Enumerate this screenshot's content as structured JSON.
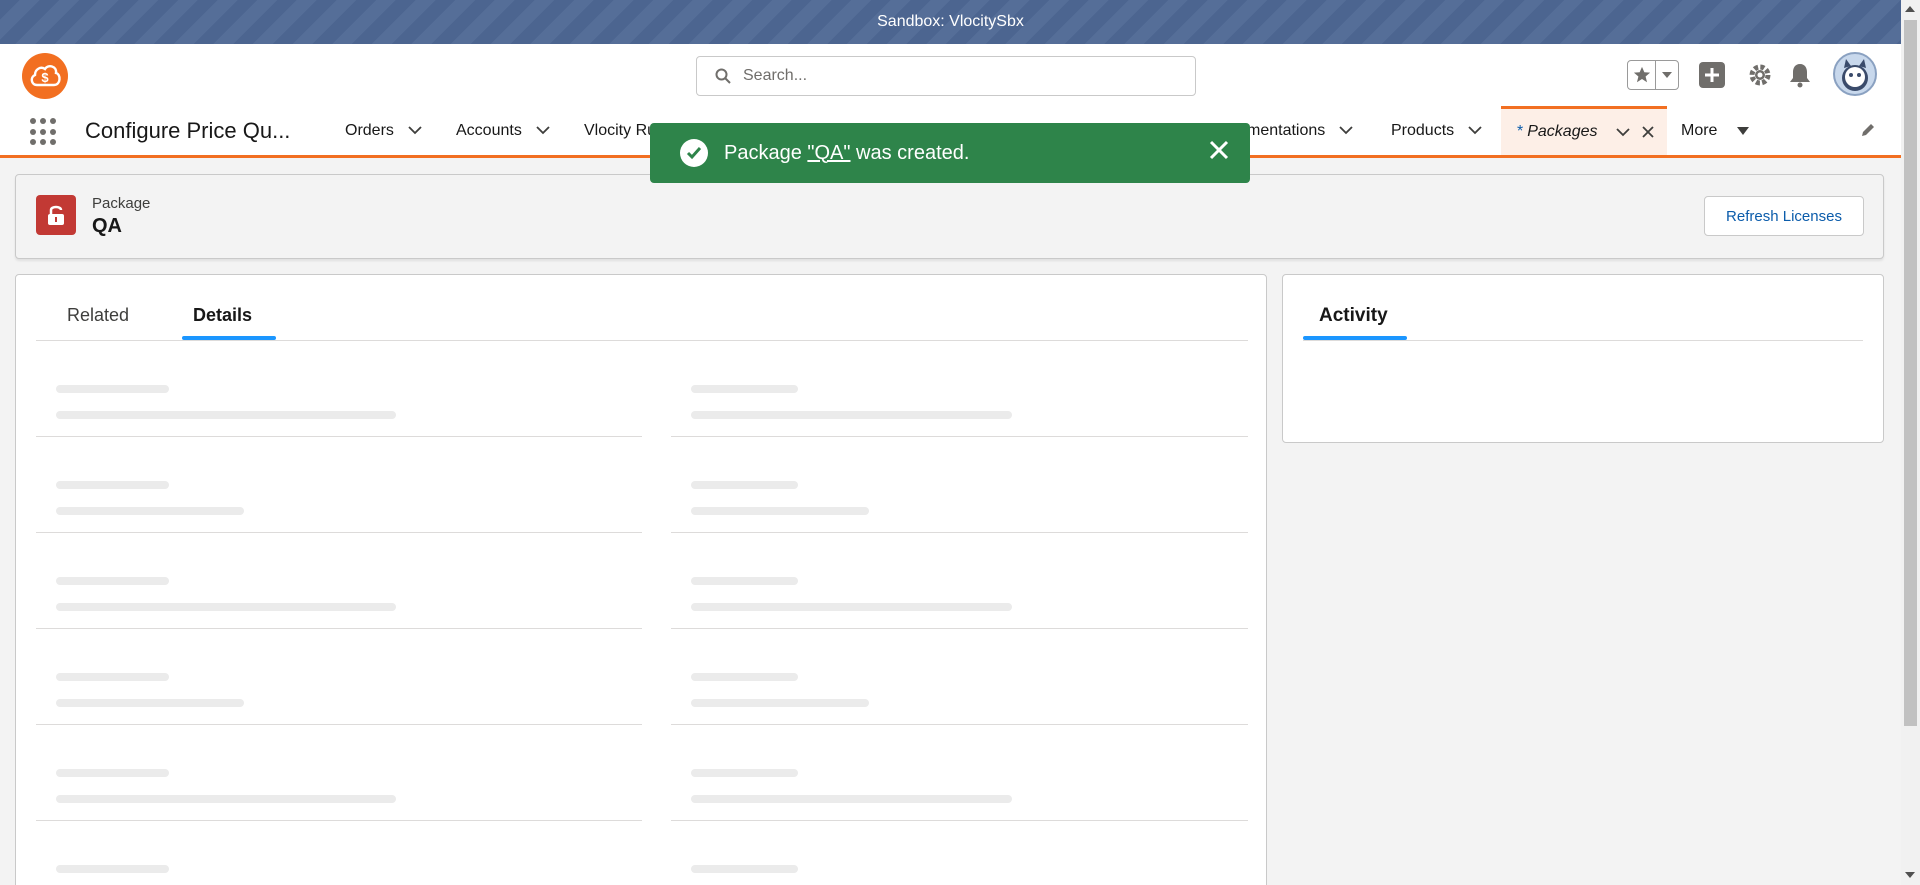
{
  "sandbox_banner": "Sandbox: VlocitySbx",
  "search": {
    "placeholder": "Search..."
  },
  "app": {
    "name": "Configure Price Qu..."
  },
  "nav": {
    "items": [
      "Orders",
      "Accounts",
      "Vlocity Ru",
      "mentations",
      "Products"
    ],
    "active_tab": {
      "prefix": "*",
      "label": "Packages"
    },
    "more_label": "More"
  },
  "toast": {
    "prefix": "Package ",
    "link": "\"QA\"",
    "suffix": " was created.",
    "color": "#2e844a"
  },
  "record": {
    "type": "Package",
    "name": "QA",
    "action": "Refresh Licenses"
  },
  "tabs": [
    {
      "label": "Related"
    },
    {
      "label": "Details",
      "active": true
    }
  ],
  "activity": {
    "title": "Activity"
  },
  "colors": {
    "brand": "#f26f21",
    "accent": "#1b96ff",
    "link": "#0b5cab",
    "record_icon": "#c23934"
  }
}
